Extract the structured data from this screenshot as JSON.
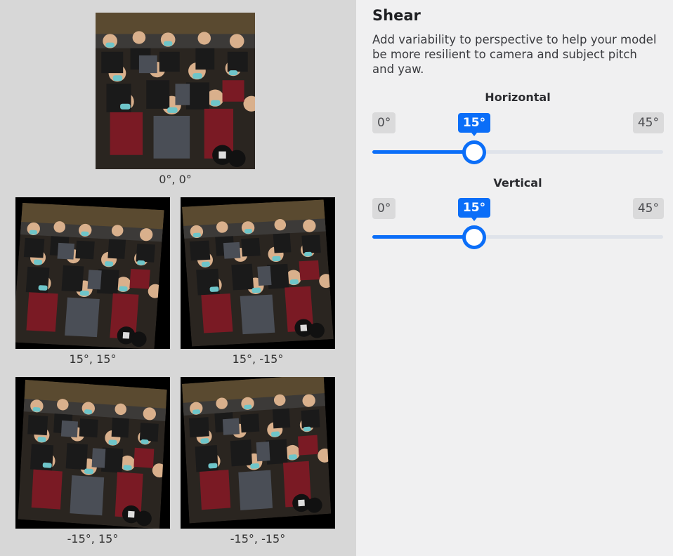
{
  "panel": {
    "title": "Shear",
    "description": "Add variability to perspective to help your model be more resilient to camera and subject pitch and yaw."
  },
  "sliders": [
    {
      "label": "Horizontal",
      "min_label": "0°",
      "max_label": "45°",
      "value_label": "15°",
      "min": 0,
      "max": 45,
      "value": 15
    },
    {
      "label": "Vertical",
      "min_label": "0°",
      "max_label": "45°",
      "value_label": "15°",
      "min": 0,
      "max": 45,
      "value": 15
    }
  ],
  "previews": {
    "original": {
      "caption": "0°, 0°"
    },
    "variants": [
      {
        "caption": "15°, 15°"
      },
      {
        "caption": "15°, -15°"
      },
      {
        "caption": "-15°, 15°"
      },
      {
        "caption": "-15°, -15°"
      }
    ]
  },
  "colors": {
    "accent": "#0b6ef8",
    "track": "#dfe3ea",
    "left_bg": "#d7d7d7",
    "right_bg": "#f0f0f1"
  }
}
